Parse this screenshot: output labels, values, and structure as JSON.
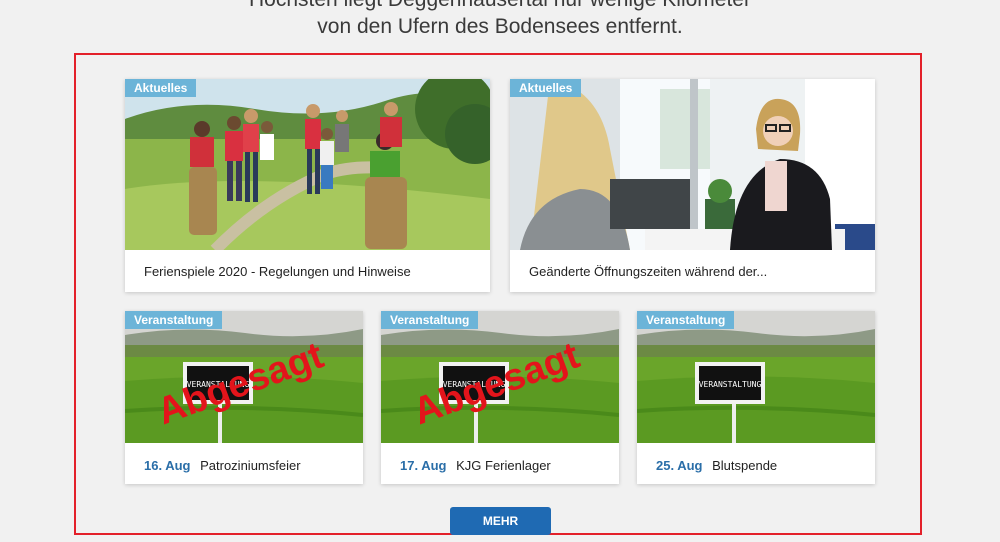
{
  "intro": {
    "line1": "Höchsten liegt Deggenhausertal nur wenige Kilometer",
    "line2": "von den Ufern des Bodensees entfernt."
  },
  "news": [
    {
      "badge": "Aktuelles",
      "title": "Ferienspiele 2020 - Regelungen und Hinweise"
    },
    {
      "badge": "Aktuelles",
      "title": "Geänderte Öffnungszeiten während der..."
    }
  ],
  "events": [
    {
      "badge": "Veranstaltung",
      "date": "16. Aug",
      "title": "Patroziniumsfeier",
      "stamp": "Abgesagt",
      "sign": "VERANSTALTUNG"
    },
    {
      "badge": "Veranstaltung",
      "date": "17. Aug",
      "title": "KJG Ferienlager",
      "stamp": "Abgesagt",
      "sign": "VERANSTALTUNG"
    },
    {
      "badge": "Veranstaltung",
      "date": "25. Aug",
      "title": "Blutspende",
      "sign": "VERANSTALTUNG"
    }
  ],
  "more_button": "MEHR",
  "colors": {
    "badge": "#6cb4d8",
    "date": "#2a6ea8",
    "button": "#1f6ab3",
    "frame": "#e3202a",
    "stamp": "#e3141b"
  }
}
